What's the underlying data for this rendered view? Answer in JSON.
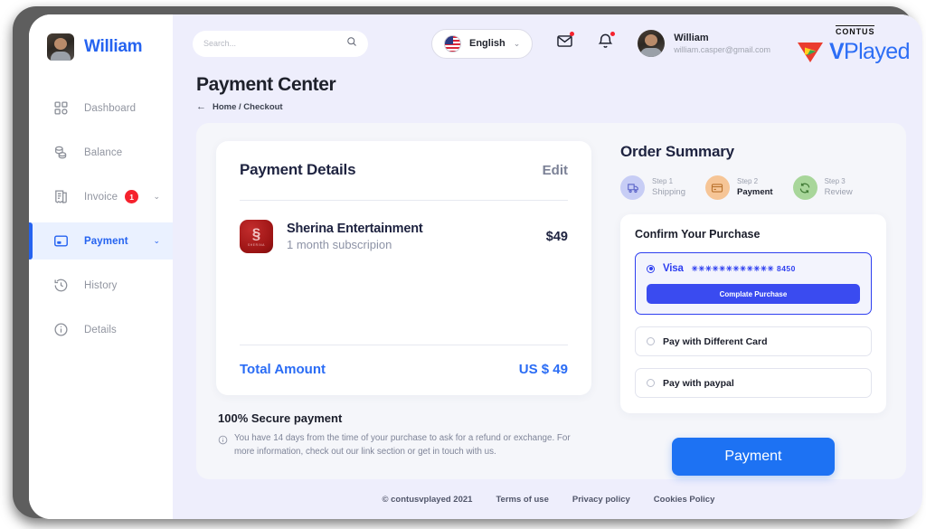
{
  "sidebar": {
    "brand_name": "William",
    "items": [
      {
        "label": "Dashboard",
        "icon": "grid-icon"
      },
      {
        "label": "Balance",
        "icon": "coins-icon"
      },
      {
        "label": "Invoice",
        "icon": "invoice-icon",
        "badge": "1",
        "chevron": "⌄"
      },
      {
        "label": "Payment",
        "icon": "card-window-icon",
        "chevron": "⌄"
      },
      {
        "label": "History",
        "icon": "history-clock-icon"
      },
      {
        "label": "Details",
        "icon": "info-circle-icon"
      }
    ]
  },
  "topbar": {
    "search_placeholder": "Search...",
    "search_value": "",
    "search_icon": "search-icon",
    "language": "English",
    "language_chevron": "⌄",
    "mail_icon": "mail-icon",
    "bell_icon": "bell-icon",
    "user_name": "William",
    "user_email": "william.casper@gmail.com",
    "logo_top": "CONTUS",
    "logo_bold": "V",
    "logo_rest": "Played"
  },
  "page": {
    "title": "Payment Center",
    "back_arrow": "←",
    "breadcrumb": "Home / Checkout"
  },
  "payment_details": {
    "title": "Payment Details",
    "edit_label": "Edit",
    "item": {
      "logo_glyph": "§",
      "logo_caption": "SHERINA",
      "name": "Sherina Entertainment",
      "subtitle": "1 month subscripion",
      "price": "$49"
    },
    "total_label": "Total Amount",
    "total_value": "US $ 49"
  },
  "secure": {
    "title": "100% Secure payment",
    "info_icon": "info-circle-icon",
    "text": "You have 14 days from the time of your purchase to ask for a refund or exchange. For more information, check out our link section or get in touch with us."
  },
  "order_summary": {
    "title": "Order Summary",
    "steps": [
      {
        "num": "Step 1",
        "name": "Shipping",
        "icon": "shipping-truck-icon",
        "bg": "#c7cdf5",
        "fg": "#5a63c8",
        "current": false
      },
      {
        "num": "Step 2",
        "name": "Payment",
        "icon": "credit-card-icon",
        "bg": "#f6c596",
        "fg": "#b9722c",
        "current": true
      },
      {
        "num": "Step 3",
        "name": "Review",
        "icon": "refresh-icon",
        "bg": "#a8d69a",
        "fg": "#3f7a34",
        "current": false
      }
    ]
  },
  "confirm": {
    "title": "Confirm Your Purchase",
    "options": [
      {
        "label": "Visa",
        "masked": "✳✳✳✳✳✳✳✳✳✳✳✳ 8450",
        "selected": true,
        "action_label": "Complate Purchase"
      },
      {
        "label": "Pay with Different Card",
        "selected": false
      },
      {
        "label": "Pay with paypal",
        "selected": false
      }
    ]
  },
  "actions": {
    "payment_label": "Payment"
  },
  "footer": {
    "copyright": "© contusvplayed 2021",
    "links": [
      "Terms of use",
      "Privacy policy",
      "Cookies Policy"
    ]
  },
  "colors": {
    "accent_blue": "#2563f0",
    "royal_blue": "#2e3ff0",
    "button_blue": "#1d72f3",
    "badge_red": "#f5222d",
    "panel_bg": "#f5f6fa",
    "main_bg": "#eeeefc"
  }
}
